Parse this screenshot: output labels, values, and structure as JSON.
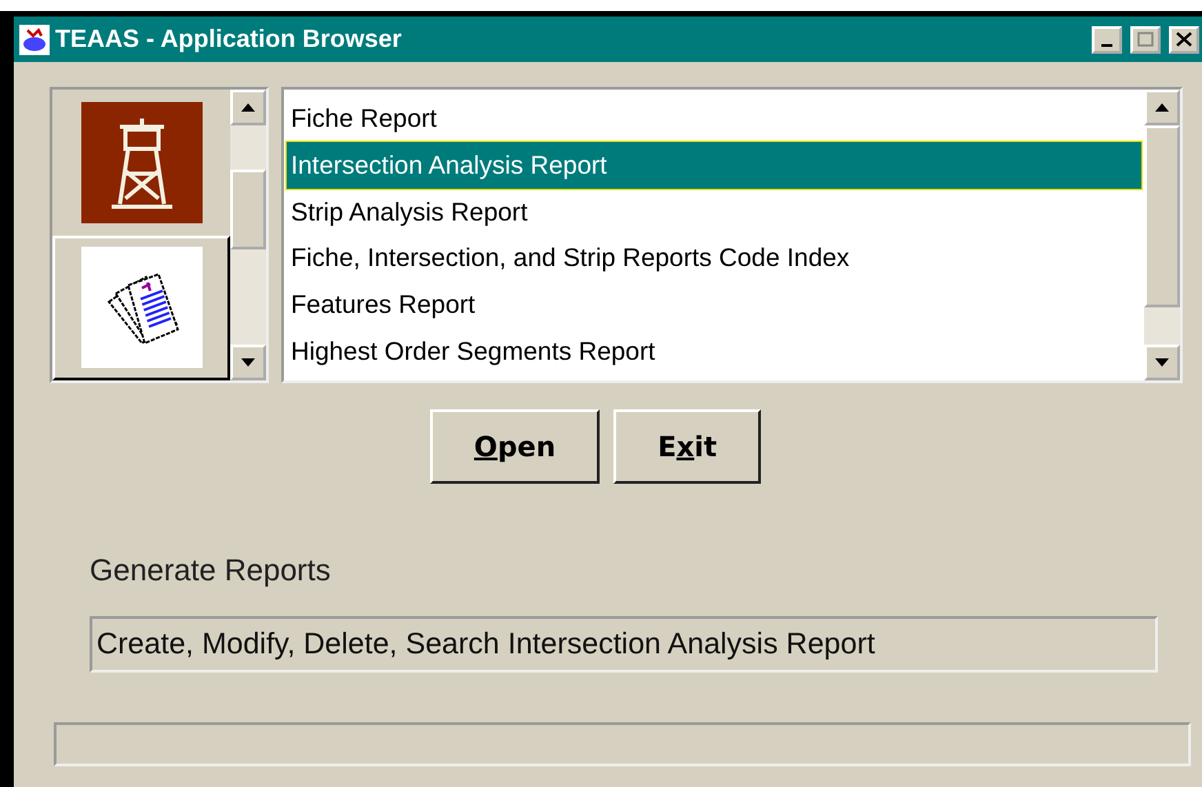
{
  "window": {
    "title": "TEAAS - Application Browser"
  },
  "categories": [
    {
      "kind": "tower",
      "selected": false
    },
    {
      "kind": "documents",
      "selected": true
    }
  ],
  "reports": [
    {
      "label": "Fiche Report",
      "selected": false
    },
    {
      "label": "Intersection Analysis Report",
      "selected": true
    },
    {
      "label": "Strip Analysis Report",
      "selected": false
    },
    {
      "label": "Fiche, Intersection, and Strip Reports Code Index",
      "selected": false
    },
    {
      "label": "Features Report",
      "selected": false
    },
    {
      "label": "Highest Order Segments Report",
      "selected": false
    }
  ],
  "buttons": [
    {
      "key": "O",
      "after": "pen"
    },
    {
      "before": "E",
      "key": "x",
      "after": "it"
    }
  ],
  "section_title": "Generate Reports",
  "description": "Create, Modify, Delete, Search Intersection Analysis Report"
}
